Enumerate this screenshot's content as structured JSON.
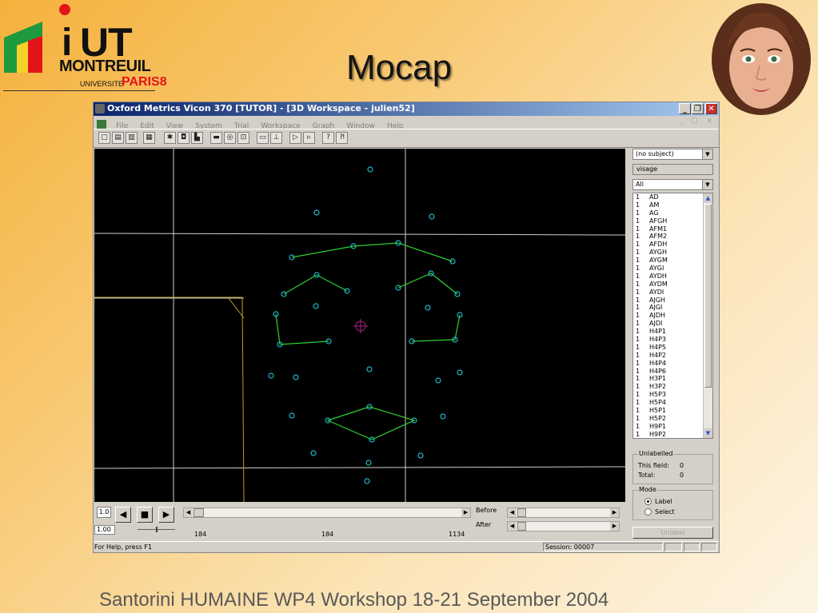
{
  "slide": {
    "title": "Mocap",
    "footer": "Santorini HUMAINE WP4 Workshop 18-21 September 2004"
  },
  "logo": {
    "line1_i": "i",
    "line1_ut": "UT",
    "line2": "MONTREUIL",
    "line3": "UNIVERSITE",
    "line3_paris": "PARIS8",
    "colors": {
      "red": "#e3131a",
      "yellow": "#f4d22a",
      "green": "#1c9a3d"
    }
  },
  "window": {
    "title": "Oxford Metrics Vicon 370 [TUTOR] - [3D Workspace - julien52]",
    "controls": {
      "minimize": "_",
      "restore": "❐",
      "close": "✕"
    },
    "menu": [
      "File",
      "Edit",
      "View",
      "System",
      "Trial",
      "Workspace",
      "Graph",
      "Window",
      "Help"
    ],
    "mdi_controls": "_ ☐ ✕",
    "toolbar_icons": [
      "new-icon",
      "open-icon",
      "save-icon",
      "print-icon",
      "person-icon",
      "cube-icon",
      "graph-icon",
      "camera-icon",
      "disk-icon",
      "reconstruct-icon",
      "label-icon",
      "axis-icon",
      "play-icon",
      "step-icon",
      "help-icon",
      "context-help-icon"
    ]
  },
  "right_panel": {
    "subject_select": "(no subject)",
    "subject_name": "visage",
    "filter_select": "All",
    "markers": [
      {
        "n": "1",
        "name": "AD"
      },
      {
        "n": "1",
        "name": "AM"
      },
      {
        "n": "1",
        "name": "AG"
      },
      {
        "n": "1",
        "name": "AFGH"
      },
      {
        "n": "1",
        "name": "AFM1"
      },
      {
        "n": "1",
        "name": "AFM2"
      },
      {
        "n": "1",
        "name": "AFDH"
      },
      {
        "n": "1",
        "name": "AYGH"
      },
      {
        "n": "1",
        "name": "AYGM"
      },
      {
        "n": "1",
        "name": "AYGI"
      },
      {
        "n": "1",
        "name": "AYDH"
      },
      {
        "n": "1",
        "name": "AYDM"
      },
      {
        "n": "1",
        "name": "AYDI"
      },
      {
        "n": "1",
        "name": "AJGH"
      },
      {
        "n": "1",
        "name": "AJGI"
      },
      {
        "n": "1",
        "name": "AJDH"
      },
      {
        "n": "1",
        "name": "AJDI"
      },
      {
        "n": "1",
        "name": "H4P1"
      },
      {
        "n": "1",
        "name": "H4P3"
      },
      {
        "n": "1",
        "name": "H4P5"
      },
      {
        "n": "1",
        "name": "H4P2"
      },
      {
        "n": "1",
        "name": "H4P4"
      },
      {
        "n": "1",
        "name": "H4P6"
      },
      {
        "n": "1",
        "name": "H3P1"
      },
      {
        "n": "1",
        "name": "H3P2"
      },
      {
        "n": "1",
        "name": "H5P3"
      },
      {
        "n": "1",
        "name": "H5P4"
      },
      {
        "n": "1",
        "name": "H5P1"
      },
      {
        "n": "1",
        "name": "H5P2"
      },
      {
        "n": "1",
        "name": "H9P1"
      },
      {
        "n": "1",
        "name": "H9P2"
      }
    ],
    "unlabelled": {
      "group_label": "Unlabelled",
      "this_field_label": "This field:",
      "this_field_value": "0",
      "total_label": "Total:",
      "total_value": "0"
    },
    "mode": {
      "group_label": "Mode",
      "options": [
        "Label",
        "Select"
      ],
      "selected": "Label"
    },
    "unlabel_button": "Unlabel"
  },
  "playback": {
    "speed_top": "1.0",
    "speed_bottom": "1.00",
    "frame_start": "184",
    "frame_current": "184",
    "frame_end": "1134",
    "before_label": "Before",
    "after_label": "After",
    "buttons": {
      "back": "◀",
      "stop": "■",
      "play": "▶"
    }
  },
  "status": {
    "help_text": "For Help, press F1",
    "session": "Session:  00007"
  },
  "colors": {
    "viewport_bg": "#000000",
    "marker": "#1fb8c8",
    "segment": "#2ed12e",
    "grid": "#cfcfcf",
    "origin": "#b0208a",
    "yellow_line": "#b8a020",
    "titlebar_start": "#0a246a",
    "titlebar_end": "#a6caf0"
  }
}
